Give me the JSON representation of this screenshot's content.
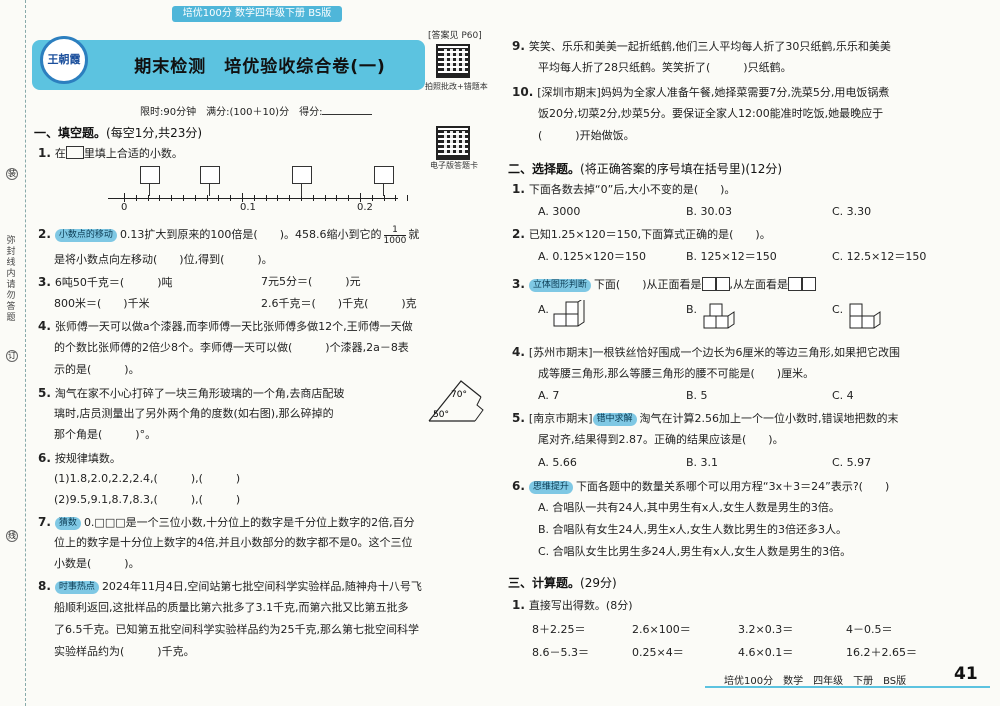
{
  "header": {
    "strip": "培优100分 数学四年级下册 BS版",
    "logo": "王朝霞",
    "title": "期末检测　培优验收综合卷(一)",
    "answer_tag": "[答案见 P60]",
    "qr1_caption": "拍照批改+错题本",
    "qr2_caption": "电子版答题卡",
    "info": "限时:90分钟　满分:(100＋10)分　得分:"
  },
  "binding": {
    "label_top": "(装",
    "label_mid": "弥封线内请勿答题",
    "circle1": "装",
    "circle2": "订",
    "circle3": "线"
  },
  "left": {
    "sec1": "一、填空题。",
    "sec1_note": "(每空1分,共23分)",
    "q1": "在",
    "q1_tail": "里填上合适的小数。",
    "numline_labels": [
      "0",
      "0.1",
      "0.2"
    ],
    "q2_tag": "小数点的移动",
    "q2_a": "0.13扩大到原来的100倍是(　　)。458.6缩小到它的",
    "q2_frac_num": "1",
    "q2_frac_den": "1000",
    "q2_b": "就",
    "q2_c": "是将小数点向左移动(　　)位,得到(　　　)。",
    "q3_a": "6吨50千克＝(　　　)吨",
    "q3_b": "7元5分＝(　　　)元",
    "q3_c": "800米＝(　　)千米",
    "q3_d": "2.6千克＝(　　)千克(　　　)克",
    "q4_a": "张师傅一天可以做a个漆器,而李师傅一天比张师傅多做12个,王师傅一天做",
    "q4_b": "的个数比张师傅的2倍少8个。李师傅一天可以做(　　　)个漆器,2a－8表",
    "q4_c": "示的是(　　　)。",
    "q5_a": "淘气在家不小心打碎了一块三角形玻璃的一个角,去商店配玻",
    "q5_b": "璃时,店员测量出了另外两个角的度数(如右图),那么碎掉的",
    "q5_c": "那个角是(　　　)°。",
    "tri_a": "70°",
    "tri_b": "50°",
    "q6": "按规律填数。",
    "q6_a": "(1)1.8,2.0,2.2,2.4,(　　　),(　　　)",
    "q6_b": "(2)9.5,9.1,8.7,8.3,(　　　),(　　　)",
    "q7_tag": "猜数",
    "q7_a": "0.□□□是一个三位小数,十分位上的数字是千分位上数字的2倍,百分",
    "q7_b": "位上的数字是十分位上数字的4倍,并且小数部分的数字都不是0。这个三位",
    "q7_c": "小数是(　　　)。",
    "q8_tag": "时事热点",
    "q8_a": "2024年11月4日,空间站第七批空间科学实验样品,随神舟十八号飞",
    "q8_b": "船顺利返回,这批样品的质量比第六批多了3.1千克,而第六批又比第五批多",
    "q8_c": "了6.5千克。已知第五批空间科学实验样品约为25千克,那么第七批空间科学",
    "q8_d": "实验样品约为(　　　)千克。"
  },
  "right": {
    "q9_a": "笑笑、乐乐和美美一起折纸鹤,他们三人平均每人折了30只纸鹤,乐乐和美美",
    "q9_b": "平均每人折了28只纸鹤。笑笑折了(　　　)只纸鹤。",
    "q10_a": "[深圳市期末]妈妈为全家人准备午餐,她择菜需要7分,洗菜5分,用电饭锅煮",
    "q10_b": "饭20分,切菜2分,炒菜5分。要保证全家人12:00能准时吃饭,她最晚应于",
    "q10_c": "(　　　)开始做饭。",
    "sec2": "二、选择题。",
    "sec2_note": "(将正确答案的序号填在括号里)(12分)",
    "c1": "下面各数去掉“0”后,大小不变的是(　　)。",
    "c1_opts": [
      "A. 3000",
      "B. 30.03",
      "C. 3.30"
    ],
    "c2": "已知1.25×120＝150,下面算式正确的是(　　)。",
    "c2_opts": [
      "A. 0.125×120＝150",
      "B. 125×12＝150",
      "C. 12.5×12＝150"
    ],
    "c3_tag": "立体图形判断",
    "c3_a": "下面(　　)从正面看是",
    "c3_b": ",从左面看是",
    "c3_opts": [
      "A.",
      "B.",
      "C."
    ],
    "c4_a": "[苏州市期末]一根铁丝恰好围成一个边长为6厘米的等边三角形,如果把它改围",
    "c4_b": "成等腰三角形,那么等腰三角形的腰不可能是(　　)厘米。",
    "c4_opts": [
      "A. 7",
      "B. 5",
      "C. 4"
    ],
    "c5_tag": "错中求解",
    "c5_a": "[南京市期末]",
    "c5_b": "淘气在计算2.56加上一个一位小数时,错误地把数的末",
    "c5_c": "尾对齐,结果得到2.87。正确的结果应该是(　　)。",
    "c5_opts": [
      "A. 5.66",
      "B. 3.1",
      "C. 5.97"
    ],
    "c6_tag": "思维提升",
    "c6_a": "下面各题中的数量关系哪个可以用方程“3x＋3＝24”表示?(　　)",
    "c6_opts": [
      "A. 合唱队一共有24人,其中男生有x人,女生人数是男生的3倍。",
      "B. 合唱队有女生24人,男生x人,女生人数比男生的3倍还多3人。",
      "C. 合唱队女生比男生多24人,男生有x人,女生人数是男生的3倍。"
    ],
    "sec3": "三、计算题。",
    "sec3_note": "(29分)",
    "k1": "直接写出得数。(8分)",
    "calc_row1": [
      "8＋2.25＝",
      "2.6×100＝",
      "3.2×0.3＝",
      "4－0.5＝"
    ],
    "calc_row2": [
      "8.6－5.3＝",
      "0.25×4＝",
      "4.6×0.1＝",
      "16.2＋2.65＝"
    ]
  },
  "footer": {
    "text": "培优100分　数学　四年级　下册　BS版",
    "page": "41"
  }
}
